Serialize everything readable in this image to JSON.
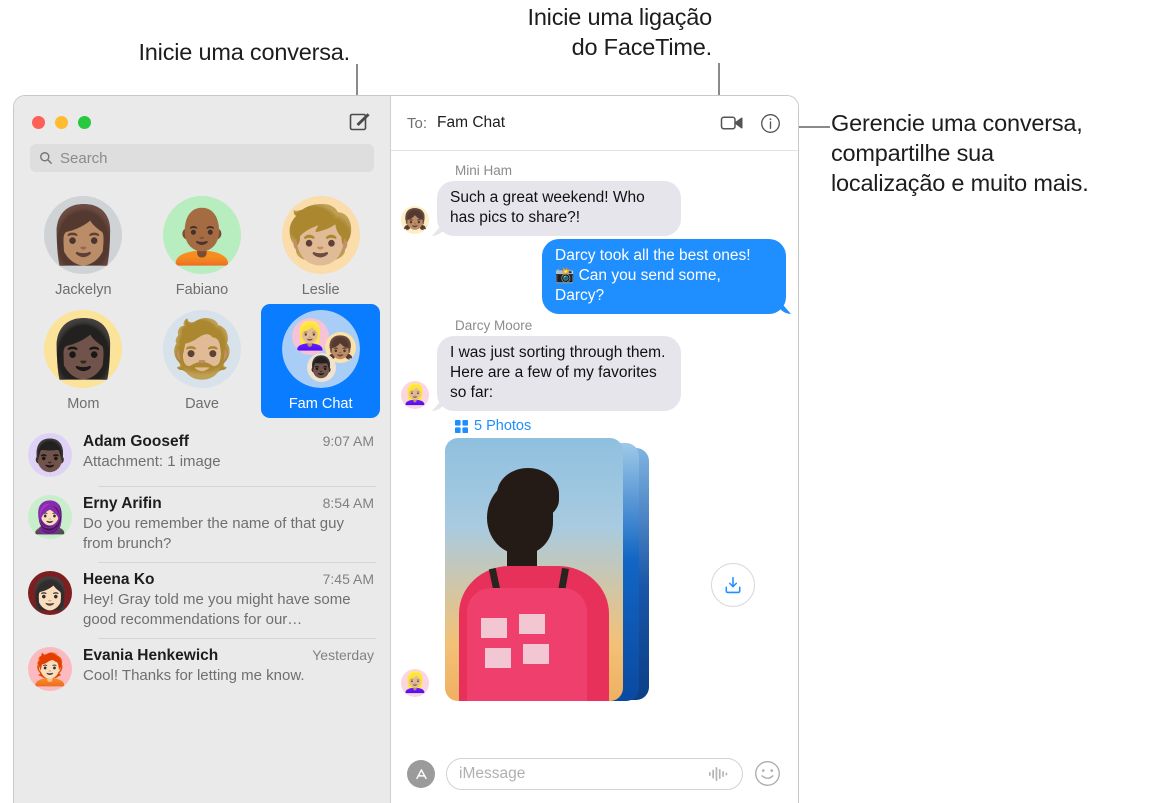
{
  "callouts": [
    {
      "id": "conversa",
      "text": "Inicie uma conversa."
    },
    {
      "id": "facetime",
      "text": "Inicie uma ligação do FaceTime."
    },
    {
      "id": "gerencie",
      "text": "Gerencie uma conversa, compartilhe sua localização e muito mais."
    }
  ],
  "callout_lines": {
    "conversa_l1": "Inicie uma conversa.",
    "facetime_l1": "Inicie uma ligação",
    "facetime_l2": "do FaceTime.",
    "gerencie_l1": "Gerencie uma conversa,",
    "gerencie_l2": "compartilhe sua",
    "gerencie_l3": "localização e muito mais."
  },
  "window": {
    "traffic_lights": {
      "close": "close-button",
      "minimize": "minimize-button",
      "maximize": "maximize-button"
    },
    "accent_color": "#0a7cff",
    "bubble_out_color": "#1f8fff",
    "bubble_in_color": "#e6e5eb",
    "sidebar_bg": "#eaeaea"
  },
  "sidebar": {
    "compose_icon": "compose-icon",
    "search": {
      "placeholder": "Search",
      "icon": "search-icon",
      "value": ""
    },
    "pinned": [
      {
        "label": "Jackelyn",
        "type": "photo",
        "bg": "#cfd3d6",
        "glyph": "👩🏽"
      },
      {
        "label": "Fabiano",
        "type": "memoji",
        "bg": "#b8edbf",
        "glyph": "🧑🏾‍🦲"
      },
      {
        "label": "Leslie",
        "type": "memoji",
        "bg": "#fbdcab",
        "glyph": "🧒🏼"
      },
      {
        "label": "Mom",
        "type": "memoji",
        "bg": "#fbe39a",
        "glyph": "👩🏿"
      },
      {
        "label": "Dave",
        "type": "photo",
        "bg": "#d7e2ea",
        "glyph": "🧔🏼"
      },
      {
        "label": "Fam Chat",
        "type": "group",
        "selected": true,
        "glyph": "👨‍👩‍👧"
      }
    ],
    "conversations": [
      {
        "name": "Adam Gooseff",
        "time": "9:07 AM",
        "preview": "Attachment: 1 image",
        "bg": "#ded3f7",
        "glyph": "👨🏿"
      },
      {
        "name": "Erny Arifin",
        "time": "8:54 AM",
        "preview": "Do you remember the name of that guy from brunch?",
        "bg": "#c9eecb",
        "glyph": "🧕🏻"
      },
      {
        "name": "Heena Ko",
        "time": "7:45 AM",
        "preview": "Hey! Gray told me you might have some good recommendations for our…",
        "bg": "#7c1f20",
        "glyph": "👩🏻"
      },
      {
        "name": "Evania Henkewich",
        "time": "Yesterday",
        "preview": "Cool! Thanks for letting me know.",
        "bg": "#fbb9c0",
        "glyph": "🧑🏻‍🦰"
      }
    ]
  },
  "thread": {
    "to_label": "To:",
    "to_value": "Fam Chat",
    "facetime_icon": "facetime-video-icon",
    "info_icon": "info-icon",
    "messages": [
      {
        "sender": "Mini Ham",
        "text": "Such a great weekend! Who has pics to share?!",
        "direction": "in",
        "avatar_bg": "#fbeec2",
        "glyph": "👧🏽"
      },
      {
        "sender": "",
        "text": "Darcy took all the best ones! 📸 Can you send some, Darcy?",
        "direction": "out"
      },
      {
        "sender": "Darcy Moore",
        "text": "I was just sorting through them. Here are a few of my favorites so far:",
        "direction": "in",
        "avatar_bg": "#fbd5e0",
        "glyph": "👱🏼‍♀️"
      }
    ],
    "attachment": {
      "label": "5 Photos",
      "count": 5,
      "grid_icon": "photo-grid-icon",
      "download_icon": "download-icon",
      "avatar_bg": "#fbd5e0",
      "avatar_glyph": "👱🏼‍♀️"
    },
    "composer": {
      "apps_icon": "app-store-icon",
      "placeholder": "iMessage",
      "value": "",
      "audio_icon": "audio-waveform-icon",
      "emoji_icon": "emoji-smiley-icon"
    }
  }
}
